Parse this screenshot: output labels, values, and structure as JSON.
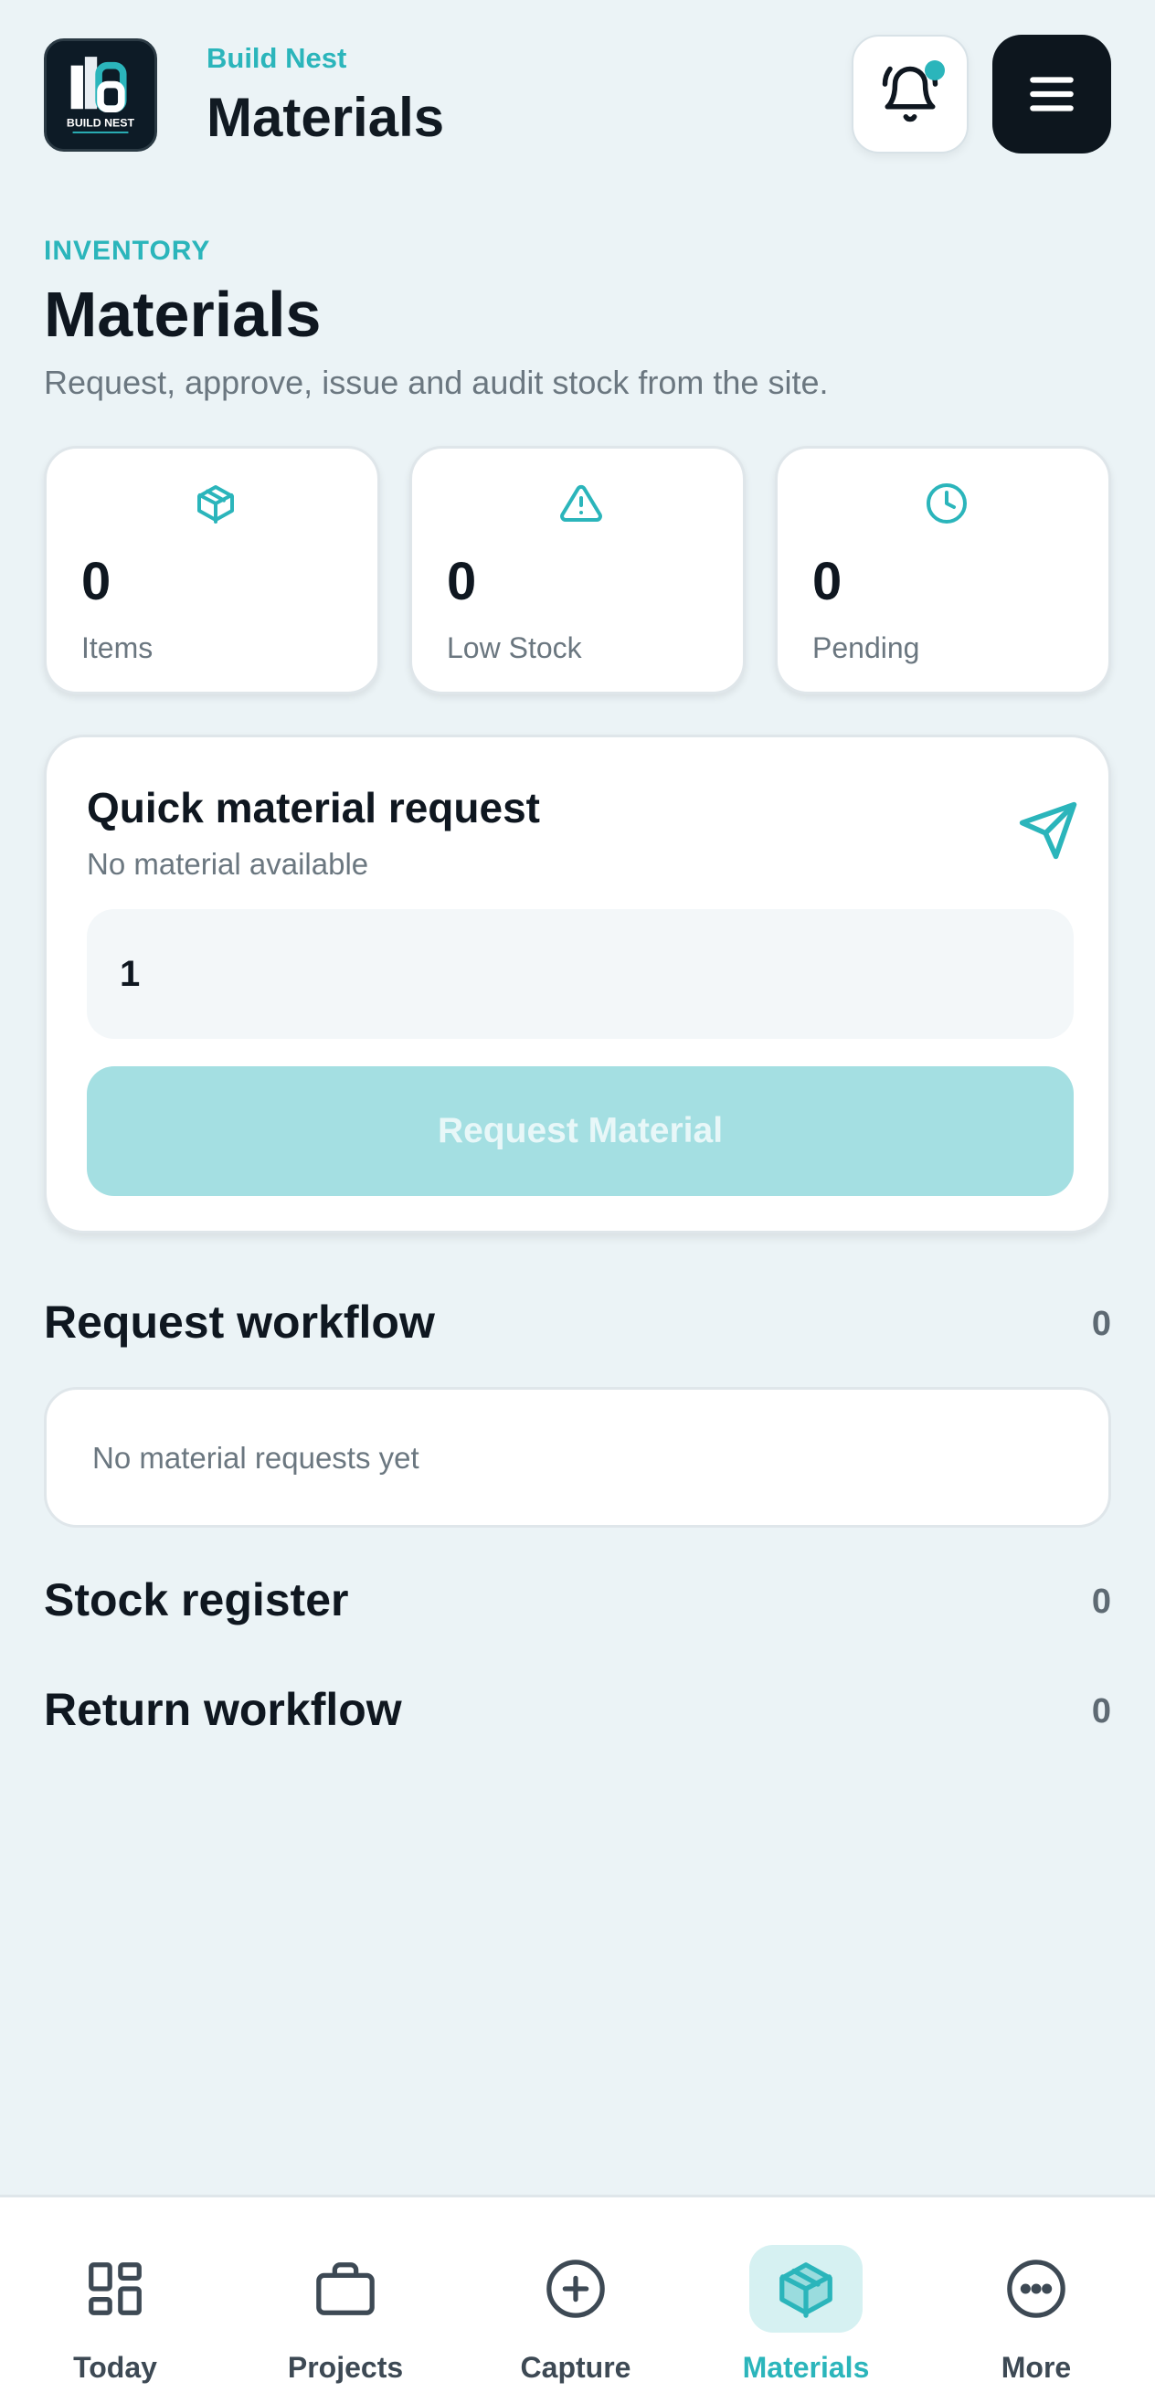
{
  "header": {
    "brand": "Build Nest",
    "title": "Materials",
    "logo_text": "BUILD NEST"
  },
  "page": {
    "eyebrow": "INVENTORY",
    "title": "Materials",
    "subtitle": "Request, approve, issue and audit stock from the site."
  },
  "stats": [
    {
      "value": "0",
      "label": "Items",
      "icon": "box-icon"
    },
    {
      "value": "0",
      "label": "Low Stock",
      "icon": "warning-icon"
    },
    {
      "value": "0",
      "label": "Pending",
      "icon": "clock-icon"
    }
  ],
  "quick_request": {
    "title": "Quick material request",
    "subtitle": "No material available",
    "quantity_value": "1",
    "button_label": "Request Material"
  },
  "sections": {
    "request_workflow": {
      "title": "Request workflow",
      "count": "0",
      "empty_text": "No material requests yet"
    },
    "stock_register": {
      "title": "Stock register",
      "count": "0"
    },
    "return_workflow": {
      "title": "Return workflow",
      "count": "0"
    }
  },
  "nav": [
    {
      "label": "Today",
      "icon": "dashboard-icon",
      "active": false
    },
    {
      "label": "Projects",
      "icon": "briefcase-icon",
      "active": false
    },
    {
      "label": "Capture",
      "icon": "plus-circle-icon",
      "active": false
    },
    {
      "label": "Materials",
      "icon": "box-icon",
      "active": true
    },
    {
      "label": "More",
      "icon": "more-icon",
      "active": false
    }
  ],
  "colors": {
    "accent": "#2bb5bb",
    "background": "#ebf3f6",
    "dark": "#0d161e",
    "disabled_button": "#a4dfe2"
  }
}
